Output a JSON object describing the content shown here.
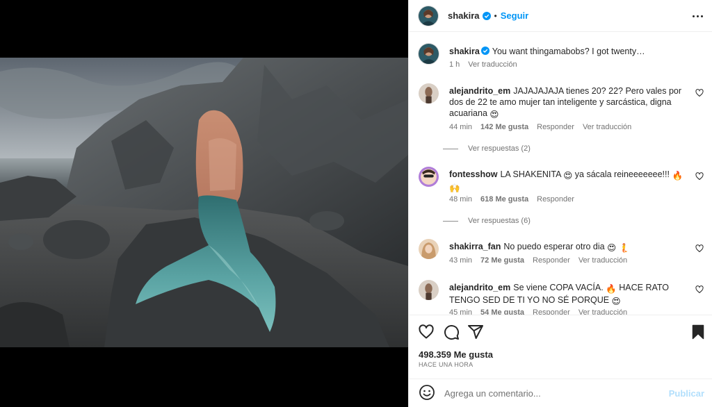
{
  "post": {
    "username": "shakira",
    "follow_label": "Seguir",
    "separator": "•",
    "more_icon": "more-horizontal-icon"
  },
  "caption": {
    "username": "shakira",
    "text": "You want thingamabobs? I got twenty…",
    "time": "1 h",
    "translate": "Ver traducción"
  },
  "comments": [
    {
      "username": "alejandrito_em",
      "text": "JAJAJAJAJA tienes 20? 22? Pero vales por dos de 22 te amo mujer tan inteligente y sarcástica, digna acuariana",
      "emoji": "😍",
      "time": "44 min",
      "likes": "142 Me gusta",
      "reply": "Responder",
      "translate": "Ver traducción",
      "replies": "Ver respuestas (2)"
    },
    {
      "username": "fontesshow",
      "text_a": "LA SHAKENITA",
      "emoji_a": "😍",
      "text_b": "ya sácala reineeeeeee!!!",
      "emoji_b": "🔥",
      "emoji_c": "🙌",
      "time": "48 min",
      "likes": "618 Me gusta",
      "reply": "Responder",
      "replies": "Ver respuestas (6)"
    },
    {
      "username": "shakirra_fan",
      "text": "No puedo esperar otro dia",
      "emoji_a": "😍",
      "emoji_b": "🧜",
      "time": "43 min",
      "likes": "72 Me gusta",
      "reply": "Responder",
      "translate": "Ver traducción"
    },
    {
      "username": "alejandrito_em",
      "text_a": "Se viene COPA VACÍA.",
      "emoji_a": "🔥",
      "text_b": "HACE RATO TENGO SED DE TI YO NO SÉ PORQUE",
      "emoji_b": "😍",
      "time": "45 min",
      "likes": "54 Me gusta",
      "reply": "Responder",
      "translate": "Ver traducción"
    }
  ],
  "actions": {
    "like_icon": "heart-icon",
    "comment_icon": "comment-icon",
    "share_icon": "send-icon",
    "save_icon": "bookmark-icon"
  },
  "likes_count": "498.359 Me gusta",
  "time_ago": "HACE UNA HORA",
  "add_comment": {
    "placeholder": "Agrega un comentario...",
    "publish": "Publicar"
  },
  "colors": {
    "link": "#0095f6",
    "publish_disabled": "#b2dffc",
    "muted": "#737373",
    "text": "#262626"
  }
}
